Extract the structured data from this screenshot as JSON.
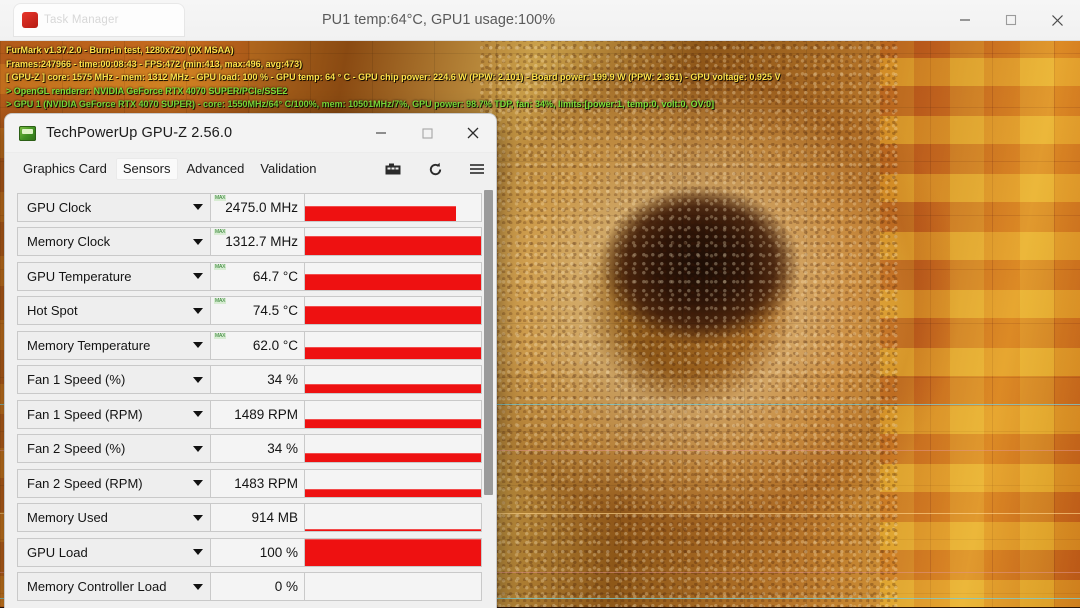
{
  "host_window": {
    "tab_title": "Task Manager",
    "status_text": "PU1 temp:64°C, GPU1 usage:100%",
    "minimize_label": "Minimize",
    "maximize_label": "Maximize",
    "close_label": "Close"
  },
  "furmark_osd": {
    "line1": "FurMark v1.37.2.0 - Burn-in test, 1280x720 (0X MSAA)",
    "line2": "Frames:247966 - time:00:08:43 - FPS:472 (min:413, max:496, avg:473)",
    "line3": "[ GPU-Z ] core: 1575 MHz - mem: 1312 MHz - GPU load: 100 % - GPU temp: 64 ° C - GPU chip power: 224.6 W (PPW: 2.101) - Board power: 199.9 W (PPW: 2.361) - GPU voltage: 0.925 V",
    "line4": "> OpenGL renderer: NVIDIA GeForce RTX 4070 SUPER/PCIe/SSE2",
    "line5": "> GPU 1 (NVIDIA GeForce RTX 4070 SUPER) - core: 1550MHz/64° C/100%, mem: 10501MHz/7%, GPU power: 98.7% TDP, fan: 34%, limits:[power:1, temp:0, volt:0, OV:0]"
  },
  "gpuz": {
    "title": "TechPowerUp GPU-Z 2.56.0",
    "app_icon": "gpuz-logo-icon",
    "window_buttons": {
      "minimize": "Minimize",
      "maximize": "Maximize",
      "close": "Close"
    },
    "tabs": [
      {
        "label": "Graphics Card",
        "active": false
      },
      {
        "label": "Sensors",
        "active": true
      },
      {
        "label": "Advanced",
        "active": false
      },
      {
        "label": "Validation",
        "active": false
      }
    ],
    "tool_icons": [
      {
        "name": "camera-icon",
        "glyph": "▤"
      },
      {
        "name": "refresh-icon",
        "glyph": "↻"
      },
      {
        "name": "menu-icon",
        "glyph": "≡"
      }
    ],
    "max_tag": "MAX",
    "sensors": [
      {
        "name": "GPU Clock",
        "value": "2475.0 MHz",
        "max_tag": true,
        "fill_pct": 86,
        "fill_height": 15
      },
      {
        "name": "Memory Clock",
        "value": "1312.7 MHz",
        "max_tag": true,
        "fill_pct": 100,
        "fill_height": 19
      },
      {
        "name": "GPU Temperature",
        "value": "64.7 °C",
        "max_tag": true,
        "fill_pct": 100,
        "fill_height": 16
      },
      {
        "name": "Hot Spot",
        "value": "74.5 °C",
        "max_tag": true,
        "fill_pct": 100,
        "fill_height": 18
      },
      {
        "name": "Memory Temperature",
        "value": "62.0 °C",
        "max_tag": true,
        "fill_pct": 100,
        "fill_height": 12
      },
      {
        "name": "Fan 1 Speed (%)",
        "value": "34 %",
        "max_tag": false,
        "fill_pct": 100,
        "fill_height": 9
      },
      {
        "name": "Fan 1 Speed (RPM)",
        "value": "1489 RPM",
        "max_tag": false,
        "fill_pct": 100,
        "fill_height": 9
      },
      {
        "name": "Fan 2 Speed (%)",
        "value": "34 %",
        "max_tag": false,
        "fill_pct": 100,
        "fill_height": 9
      },
      {
        "name": "Fan 2 Speed (RPM)",
        "value": "1483 RPM",
        "max_tag": false,
        "fill_pct": 100,
        "fill_height": 8
      },
      {
        "name": "Memory Used",
        "value": "914 MB",
        "max_tag": false,
        "fill_pct": 100,
        "fill_height": 2
      },
      {
        "name": "GPU Load",
        "value": "100 %",
        "max_tag": false,
        "fill_pct": 100,
        "fill_height": 27
      },
      {
        "name": "Memory Controller Load",
        "value": "0 %",
        "max_tag": false,
        "fill_pct": 0,
        "fill_height": 0
      }
    ]
  },
  "colors": {
    "graph_red": "#ee1111",
    "osd_yellow": "#ffe24a",
    "osd_green": "#7ee03a",
    "window_bg": "#f0f0f0"
  }
}
